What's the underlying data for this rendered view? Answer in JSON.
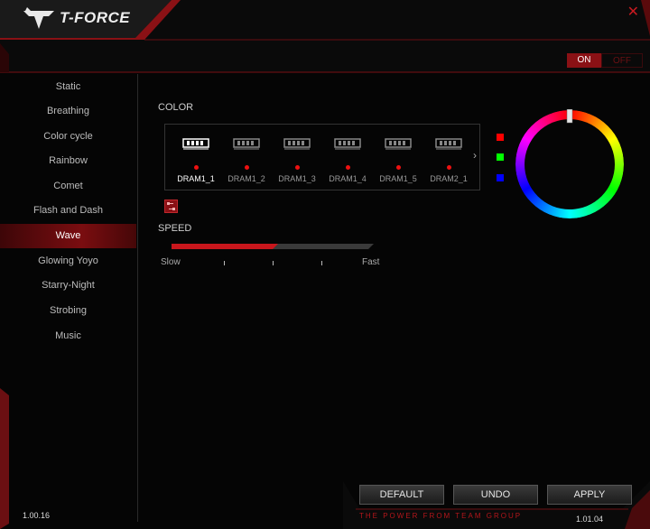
{
  "brand": "T-FORCE",
  "window": {
    "close_glyph": "✕"
  },
  "power_toggle": {
    "on": "ON",
    "off": "OFF"
  },
  "sidebar": {
    "items": [
      {
        "label": "Static",
        "active": false
      },
      {
        "label": "Breathing",
        "active": false
      },
      {
        "label": "Color cycle",
        "active": false
      },
      {
        "label": "Rainbow",
        "active": false
      },
      {
        "label": "Comet",
        "active": false
      },
      {
        "label": "Flash and Dash",
        "active": false
      },
      {
        "label": "Wave",
        "active": true
      },
      {
        "label": "Glowing Yoyo",
        "active": false
      },
      {
        "label": "Starry-Night",
        "active": false
      },
      {
        "label": "Strobing",
        "active": false
      },
      {
        "label": "Music",
        "active": false
      }
    ]
  },
  "color_section": {
    "label": "COLOR",
    "modules": [
      {
        "label": "DRAM1_1",
        "selected": true
      },
      {
        "label": "DRAM1_2",
        "selected": false
      },
      {
        "label": "DRAM1_3",
        "selected": false
      },
      {
        "label": "DRAM1_4",
        "selected": false
      },
      {
        "label": "DRAM1_5",
        "selected": false
      },
      {
        "label": "DRAM2_1",
        "selected": false
      }
    ],
    "next_glyph": "›"
  },
  "speed": {
    "label": "SPEED",
    "min_label": "Slow",
    "max_label": "Fast",
    "level": 0.5
  },
  "rgb_swatches": [
    "#ff0000",
    "#00ff00",
    "#0000ff"
  ],
  "footer": {
    "buttons": {
      "default": "DEFAULT",
      "undo": "UNDO",
      "apply": "APPLY"
    },
    "tagline": "THE POWER FROM TEAM GROUP",
    "version_left": "1.00.16",
    "version_right": "1.01.04"
  }
}
